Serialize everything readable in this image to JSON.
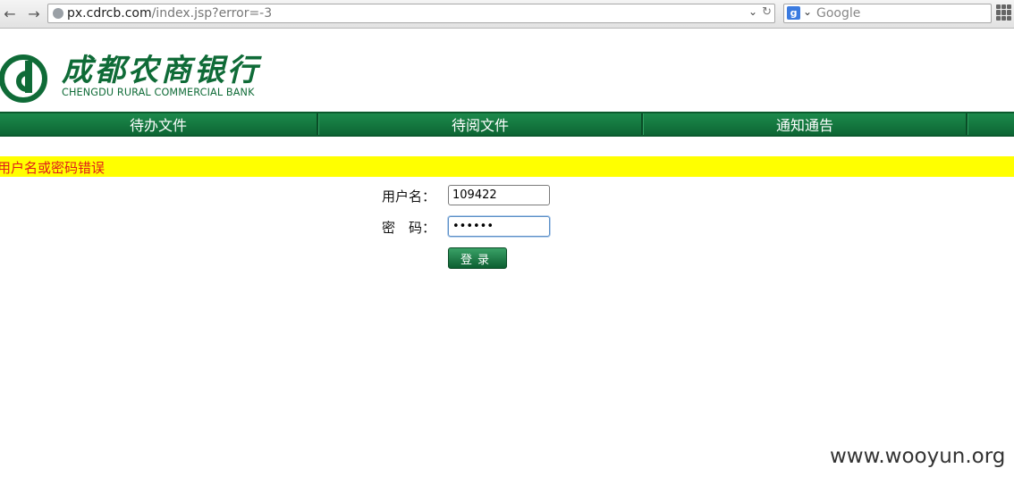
{
  "browser": {
    "url_domain": "px.cdrcb.com",
    "url_path": "/index.jsp?error=-3",
    "search_placeholder": "Google"
  },
  "bank": {
    "name_cn": "成都农商银行",
    "name_en": "CHENGDU RURAL COMMERCIAL BANK",
    "brand_color": "#0f6b37"
  },
  "menu": {
    "items": [
      {
        "label": "待办文件"
      },
      {
        "label": "待阅文件"
      },
      {
        "label": "通知通告"
      }
    ]
  },
  "error": {
    "message": "用户名或密码错误",
    "background": "#ffff00",
    "color": "#e01b1b"
  },
  "login": {
    "username_label": "用户名：",
    "username_value": "109422",
    "password_label": "密　码：",
    "password_value": "••••••",
    "submit_label": "登录"
  },
  "watermark": "www.wooyun.org"
}
